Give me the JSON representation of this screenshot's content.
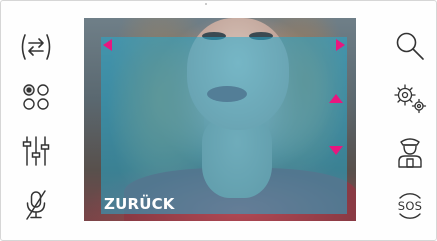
{
  "colors": {
    "accent": "#e8177f",
    "overlay": "#24aacd",
    "icon": "#333333"
  },
  "left_toolbar": {
    "items": [
      {
        "icon": "swap-arrows-icon",
        "action": "switch-camera"
      },
      {
        "icon": "four-circles-icon",
        "action": "menu"
      },
      {
        "icon": "sliders-icon",
        "action": "settings-adjust"
      },
      {
        "icon": "muted-microphone-icon",
        "action": "mute"
      }
    ]
  },
  "right_toolbar": {
    "items": [
      {
        "icon": "search-icon",
        "action": "zoom"
      },
      {
        "icon": "gears-icon",
        "action": "settings"
      },
      {
        "icon": "concierge-icon",
        "action": "call-concierge"
      },
      {
        "icon": "sos-icon",
        "label": "SOS",
        "action": "sos"
      }
    ]
  },
  "video": {
    "back_label": "ZURÜCK"
  }
}
